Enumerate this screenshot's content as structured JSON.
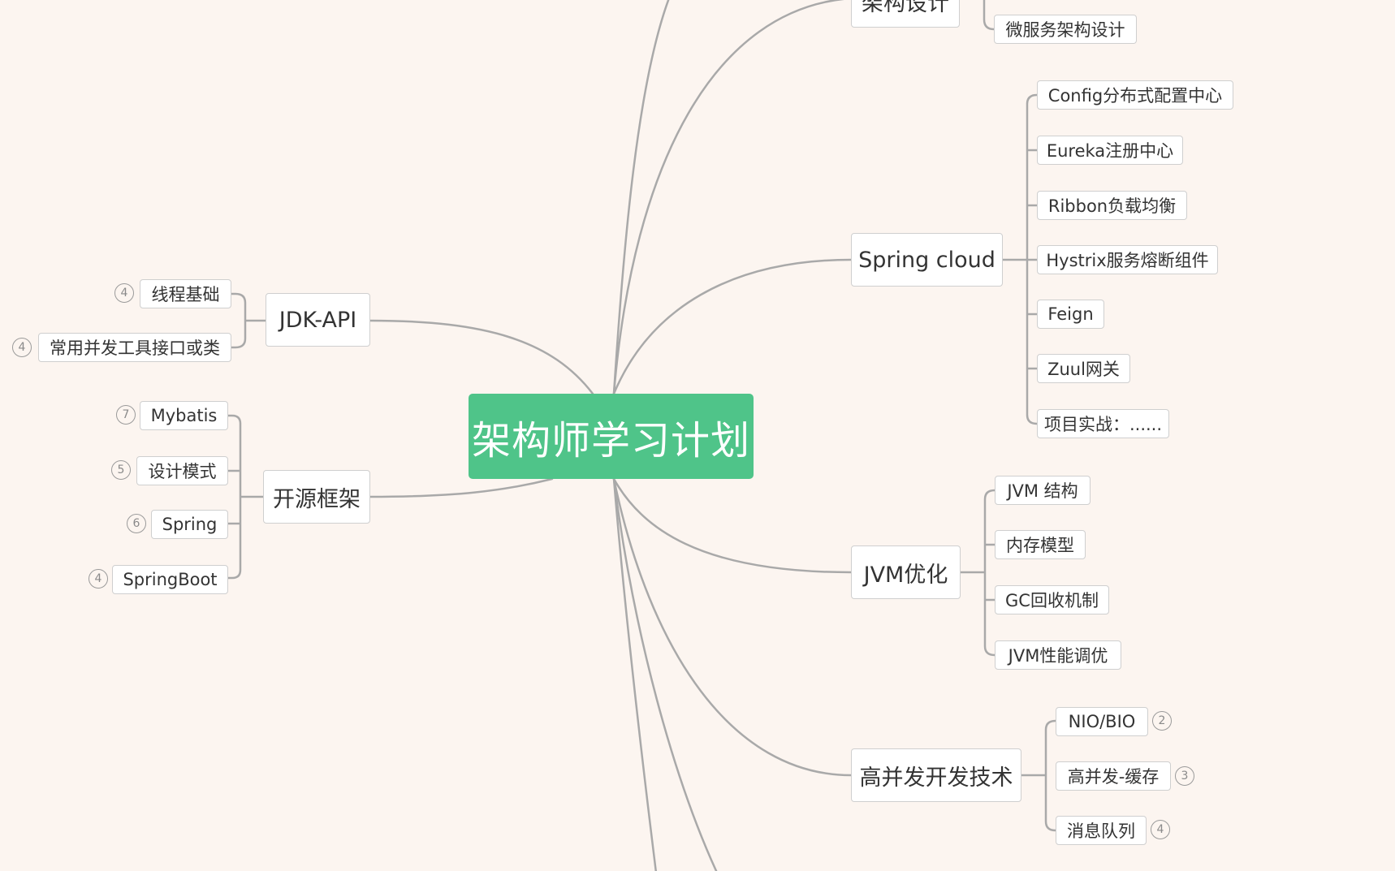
{
  "root": {
    "label": "架构师学习计划"
  },
  "left": {
    "jdk_api": {
      "label": "JDK-API",
      "children": [
        {
          "label": "线程基础",
          "count": "4"
        },
        {
          "label": "常用并发工具接口或类",
          "count": "4"
        }
      ]
    },
    "open_source": {
      "label": "开源框架",
      "children": [
        {
          "label": "Mybatis",
          "count": "7"
        },
        {
          "label": "设计模式",
          "count": "5"
        },
        {
          "label": "Spring",
          "count": "6"
        },
        {
          "label": "SpringBoot",
          "count": "4"
        }
      ]
    }
  },
  "right": {
    "arch_design": {
      "label": "架构设计",
      "children": [
        {
          "label": "微服务架构设计"
        }
      ]
    },
    "spring_cloud": {
      "label": "Spring cloud",
      "children": [
        {
          "label": "Config分布式配置中心"
        },
        {
          "label": "Eureka注册中心"
        },
        {
          "label": "Ribbon负载均衡"
        },
        {
          "label": "Hystrix服务熔断组件"
        },
        {
          "label": "Feign"
        },
        {
          "label": "Zuul网关"
        },
        {
          "label": "项目实战：......"
        }
      ]
    },
    "jvm": {
      "label": "JVM优化",
      "children": [
        {
          "label": "JVM 结构"
        },
        {
          "label": "内存模型"
        },
        {
          "label": "GC回收机制"
        },
        {
          "label": "JVM性能调优"
        }
      ]
    },
    "concurrency": {
      "label": "高并发开发技术",
      "children": [
        {
          "label": "NIO/BIO",
          "count": "2"
        },
        {
          "label": "高并发-缓存",
          "count": "3"
        },
        {
          "label": "消息队列",
          "count": "4"
        }
      ]
    }
  }
}
